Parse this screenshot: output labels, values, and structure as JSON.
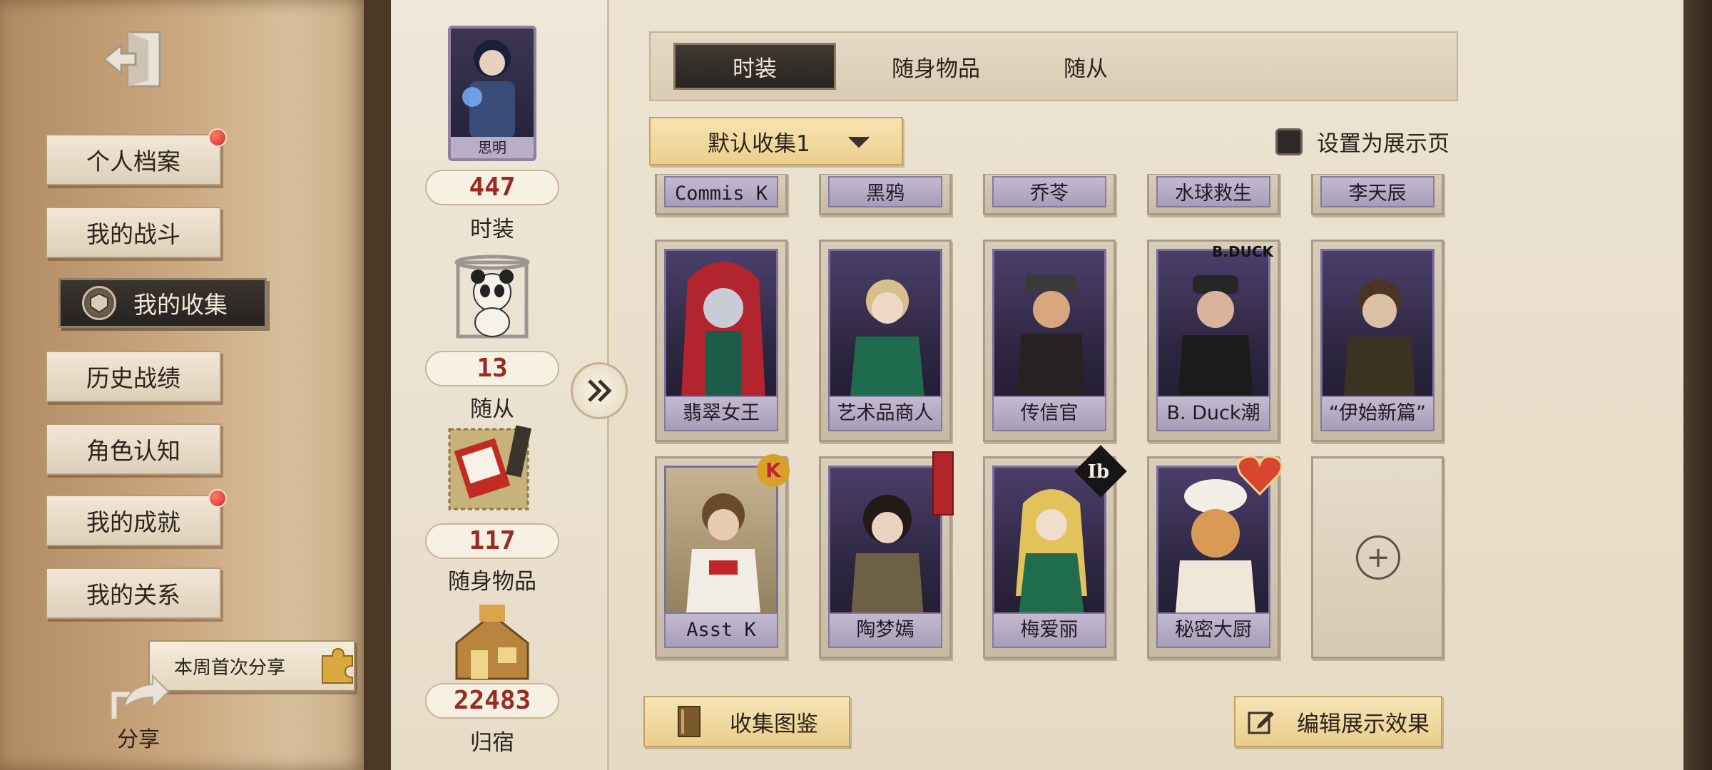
{
  "sidebar": {
    "items": [
      {
        "label": "个人档案",
        "notify": true
      },
      {
        "label": "我的战斗",
        "notify": false
      },
      {
        "label": "我的收集",
        "active": true
      },
      {
        "label": "历史战绩",
        "notify": false
      },
      {
        "label": "角色认知",
        "notify": false
      },
      {
        "label": "我的成就",
        "notify": true
      },
      {
        "label": "我的关系",
        "notify": false
      }
    ],
    "share_banner": "本周首次分享",
    "share_label": "分享"
  },
  "stats": {
    "character_name": "思明",
    "costume_count": "447",
    "costume_label": "时装",
    "pet_count": "13",
    "pet_label": "随从",
    "accessory_count": "117",
    "accessory_label": "随身物品",
    "home_count": "22483",
    "home_label": "归宿"
  },
  "tabs": [
    {
      "label": "时装",
      "active": true
    },
    {
      "label": "随身物品",
      "active": false
    },
    {
      "label": "随从",
      "active": false
    }
  ],
  "collection_select": "默认收集1",
  "display_toggle_label": "设置为展示页",
  "cards_top_row": [
    "Commis K",
    "黑鸦",
    "乔苓",
    "水球救生",
    "李天辰"
  ],
  "cards_row1": [
    "翡翠女王",
    "艺术品商人",
    "传信官",
    "B. Duck潮",
    "“伊始新篇”"
  ],
  "cards_row2": [
    "Asst K",
    "陶梦嫣",
    "梅爱丽",
    "秘密大厨"
  ],
  "card_badges": {
    "row1_3": "B.DUCK",
    "row2_2": "Ib",
    "row2_0": "K"
  },
  "buttons": {
    "collection_guide": "收集图鉴",
    "edit_display": "编辑展示效果"
  },
  "colors": {
    "count_red": "#9a2a22",
    "active_tab_bg": "#2a2521",
    "accent_gold": "#eccf8e",
    "notify_red": "#d0271f"
  }
}
